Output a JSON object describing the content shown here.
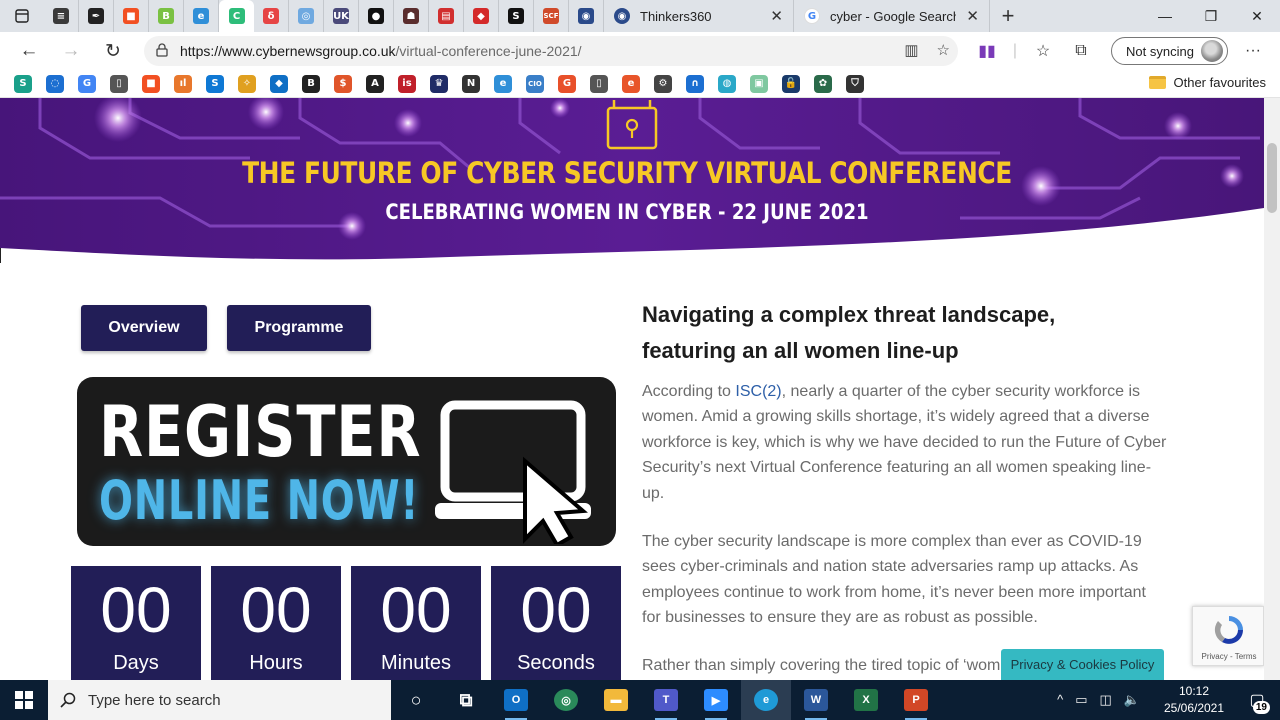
{
  "browser": {
    "tabs": [
      {
        "kind": "icon",
        "icon": "newspaper-icon",
        "color": "#3a3a3a",
        "glyph": "≡"
      },
      {
        "kind": "icon",
        "icon": "pen-icon",
        "color": "#222222",
        "glyph": "✒"
      },
      {
        "kind": "icon",
        "icon": "windows-logo-icon",
        "color": "#f25022",
        "glyph": "■"
      },
      {
        "kind": "icon",
        "icon": "b-green-icon",
        "color": "#7ac143",
        "glyph": "B"
      },
      {
        "kind": "icon",
        "icon": "edge-blue-icon",
        "color": "#2f8fd8",
        "glyph": "e"
      },
      {
        "kind": "icon",
        "icon": "c-green-icon",
        "color": "#2ebd7a",
        "glyph": "C",
        "active": true
      },
      {
        "kind": "icon",
        "icon": "red-shield-icon",
        "color": "#e64545",
        "glyph": "δ"
      },
      {
        "kind": "icon",
        "icon": "globe-icon",
        "color": "#6fa9e0",
        "glyph": "◎"
      },
      {
        "kind": "icon",
        "icon": "uk-icon",
        "color": "#4a4a7a",
        "glyph": "UK"
      },
      {
        "kind": "icon",
        "icon": "dots-icon",
        "color": "#111111",
        "glyph": "●"
      },
      {
        "kind": "icon",
        "icon": "cat-icon",
        "color": "#5a2d2d",
        "glyph": "☗"
      },
      {
        "kind": "icon",
        "icon": "red-square-icon",
        "color": "#d12f2f",
        "glyph": "▤"
      },
      {
        "kind": "icon",
        "icon": "red-diamond-icon",
        "color": "#d42a2a",
        "glyph": "◆"
      },
      {
        "kind": "icon",
        "icon": "s-black-icon",
        "color": "#111111",
        "glyph": "S"
      },
      {
        "kind": "icon",
        "icon": "scf-icon",
        "color": "#d04a2a",
        "glyph": "SCF"
      },
      {
        "kind": "icon",
        "icon": "circle-logo-icon",
        "color": "#2a4a8a",
        "glyph": "◉"
      }
    ],
    "wide_tabs": [
      {
        "title": "Thinkers360",
        "icon": "thinkers-icon",
        "color": "#2a4a8a"
      },
      {
        "title": "cyber - Google Search",
        "icon": "google-icon",
        "color": "#4285f4"
      }
    ],
    "url_host": "https://www.cybernewsgroup.co.uk",
    "url_path": "/virtual-conference-june-2021/",
    "sync_label": "Not syncing",
    "other_favourites": "Other favourites",
    "favourites": [
      {
        "icon": "s-teal-icon",
        "color": "#1aa08a",
        "glyph": "S"
      },
      {
        "icon": "spiral-icon",
        "color": "#1c6fd1",
        "glyph": "◌"
      },
      {
        "icon": "google-icon",
        "color": "#4285f4",
        "glyph": "G"
      },
      {
        "icon": "document-icon",
        "color": "#555555",
        "glyph": "▯"
      },
      {
        "icon": "windows-logo-icon",
        "color": "#f25022",
        "glyph": "■"
      },
      {
        "icon": "bars-icon",
        "color": "#e8772c",
        "glyph": "ıl"
      },
      {
        "icon": "sharepoint-icon",
        "color": "#0f78d4",
        "glyph": "S"
      },
      {
        "icon": "mixer-icon",
        "color": "#e0a020",
        "glyph": "✧"
      },
      {
        "icon": "outlook-icon",
        "color": "#0f6fc5",
        "glyph": "◆"
      },
      {
        "icon": "bbc-icon",
        "color": "#222222",
        "glyph": "B"
      },
      {
        "icon": "s-orange-icon",
        "color": "#e0552a",
        "glyph": "$"
      },
      {
        "icon": "pen-icon",
        "color": "#222222",
        "glyph": "A"
      },
      {
        "icon": "is-icon",
        "color": "#c0202a",
        "glyph": "is"
      },
      {
        "icon": "crest-icon",
        "color": "#1f2b66",
        "glyph": "♛"
      },
      {
        "icon": "nist-icon",
        "color": "#333333",
        "glyph": "N"
      },
      {
        "icon": "edge-blue-icon",
        "color": "#2f8fd8",
        "glyph": "e"
      },
      {
        "icon": "cio-icon",
        "color": "#3a7fc8",
        "glyph": "CIO"
      },
      {
        "icon": "g-orange-icon",
        "color": "#e8502a",
        "glyph": "G"
      },
      {
        "icon": "page-icon",
        "color": "#555555",
        "glyph": "▯"
      },
      {
        "icon": "e-orange-icon",
        "color": "#e8552a",
        "glyph": "e"
      },
      {
        "icon": "bike-icon",
        "color": "#444444",
        "glyph": "⚙"
      },
      {
        "icon": "headset-icon",
        "color": "#1c6fd1",
        "glyph": "∩"
      },
      {
        "icon": "circle-teal-icon",
        "color": "#2aa8c8",
        "glyph": "◍"
      },
      {
        "icon": "lock-green-icon",
        "color": "#7fc8a0",
        "glyph": "▣"
      },
      {
        "icon": "unlock-icon",
        "color": "#1a3a6a",
        "glyph": "🔓"
      },
      {
        "icon": "gear-green-icon",
        "color": "#2a6a4a",
        "glyph": "✿"
      },
      {
        "icon": "shield-icon",
        "color": "#333333",
        "glyph": "⛉"
      }
    ]
  },
  "page": {
    "banner": {
      "title": "THE FUTURE OF CYBER SECURITY VIRTUAL CONFERENCE",
      "subtitle": "CELEBRATING WOMEN IN CYBER - 22 JUNE 2021"
    },
    "buttons": {
      "overview": "Overview",
      "programme": "Programme"
    },
    "register": {
      "line1": "REGISTER",
      "line2": "ONLINE NOW!"
    },
    "countdown": [
      {
        "value": "00",
        "label": "Days"
      },
      {
        "value": "00",
        "label": "Hours"
      },
      {
        "value": "00",
        "label": "Minutes"
      },
      {
        "value": "00",
        "label": "Seconds"
      }
    ],
    "article": {
      "heading": "Navigating a complex threat landscape, featuring an all women line-up",
      "p1_before": "According to ",
      "p1_link": "ISC(2)",
      "p1_after": ", nearly a quarter of the cyber security workforce is women. Amid a growing skills shortage, it’s widely agreed that a diverse workforce is key, which is why we have decided to run the Future of Cyber Security’s next Virtual Conference featuring an all women speaking line-up.",
      "p2": "The cyber security landscape is more complex than ever as COVID-19 sees cyber-criminals and nation state adversaries ramp up attacks. As employees continue to work from home, it’s never been more important for businesses to ensure they are as robust as possible.",
      "p3": "Rather than simply covering the tired topic of ‘wom"
    },
    "recaptcha": "Privacy - Terms",
    "privacy_button": "Privacy & Cookies Policy"
  },
  "taskbar": {
    "search_placeholder": "Type here to search",
    "time": "10:12",
    "date": "25/06/2021",
    "notification_count": "19",
    "apps": [
      {
        "icon": "cortana-icon",
        "color": "transparent",
        "glyph": "○"
      },
      {
        "icon": "task-view-icon",
        "color": "transparent",
        "glyph": "⧉"
      },
      {
        "icon": "outlook-icon",
        "color": "#0f6fc5",
        "glyph": "O",
        "running": true
      },
      {
        "icon": "globe-icon",
        "color": "#2a8a5a",
        "glyph": "◎"
      },
      {
        "icon": "file-explorer-icon",
        "color": "#f2b93b",
        "glyph": "▬"
      },
      {
        "icon": "teams-icon",
        "color": "#5059c9",
        "glyph": "T",
        "running": true
      },
      {
        "icon": "zoom-icon",
        "color": "#2d8cff",
        "glyph": "▶",
        "running": true
      },
      {
        "icon": "edge-icon",
        "color": "#1f9ad6",
        "glyph": "e",
        "active": true
      },
      {
        "icon": "word-icon",
        "color": "#2b579a",
        "glyph": "W",
        "running": true
      },
      {
        "icon": "excel-icon",
        "color": "#217346",
        "glyph": "X"
      },
      {
        "icon": "powerpoint-icon",
        "color": "#d24726",
        "glyph": "P",
        "running": true
      }
    ]
  }
}
